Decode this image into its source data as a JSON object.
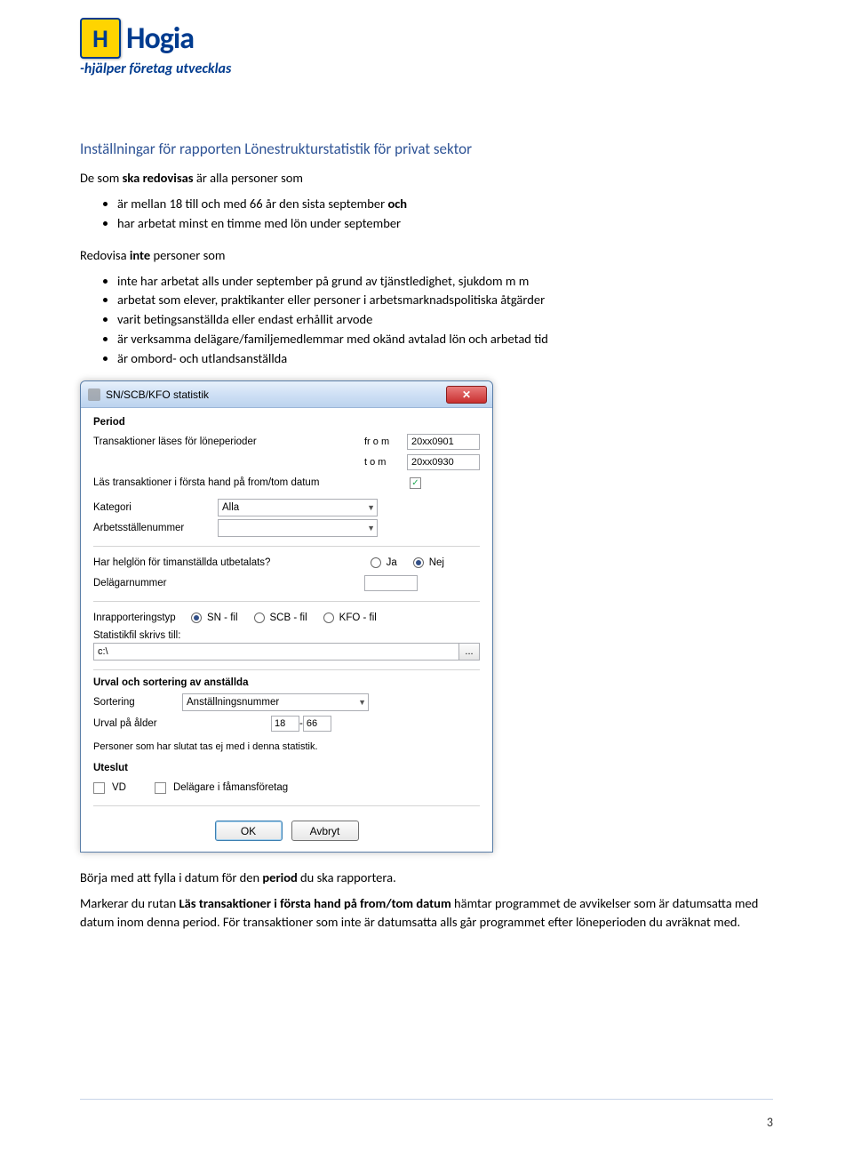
{
  "logo": {
    "letter": "H",
    "brand": "Hogia",
    "tagline": "-hjälper företag utvecklas"
  },
  "heading": "Inställningar för rapporten Lönestrukturstatistik för privat sektor",
  "intro1_pre": "De som ",
  "intro1_b": "ska redovisas",
  "intro1_post": " är alla personer som",
  "list1": {
    "i0_pre": "är mellan 18 till och med 66 år den sista september ",
    "i0_b": "och",
    "i1": "har arbetat minst en timme med lön under september"
  },
  "intro2_pre": "Redovisa ",
  "intro2_b": "inte",
  "intro2_post": " personer som",
  "list2": {
    "i0": "inte har arbetat alls under september på grund av tjänstledighet, sjukdom m m",
    "i1": "arbetat som elever, praktikanter eller personer i arbetsmarknadspolitiska åtgärder",
    "i2": "varit betingsanställda eller endast erhållit arvode",
    "i3": "är verksamma delägare/familjemedlemmar med okänd avtalad lön och arbetad tid",
    "i4": "är ombord- och utlandsanställda"
  },
  "dialog": {
    "title": "SN/SCB/KFO statistik",
    "period_title": "Period",
    "period_line": "Transaktioner läses för löneperioder",
    "from_lbl": "fr o m",
    "from_val": "20xx0901",
    "to_lbl": "t o m",
    "to_val": "20xx0930",
    "read_trans": "Läs transaktioner i första hand på from/tom datum",
    "kategori_lbl": "Kategori",
    "kategori_val": "Alla",
    "arbets_lbl": "Arbetsställenummer",
    "helglon": "Har helglön för timanställda utbetalats?",
    "ja": "Ja",
    "nej": "Nej",
    "delagarnr": "Delägarnummer",
    "inrapp": "Inrapporteringstyp",
    "sn": "SN - fil",
    "scb": "SCB - fil",
    "kfo": "KFO - fil",
    "statfil": "Statistikfil skrivs till:",
    "path": "c:\\",
    "urval_title": "Urval och sortering av anställda",
    "sort_lbl": "Sortering",
    "sort_val": "Anställningsnummer",
    "alder_lbl": "Urval på ålder",
    "alder_from": "18",
    "alder_sep": " - ",
    "alder_to": "66",
    "note": "Personer som har slutat tas ej med i denna statistik.",
    "uteslut_title": "Uteslut",
    "vd": "VD",
    "delagare": "Delägare i fåmansföretag",
    "ok": "OK",
    "avbryt": "Avbryt"
  },
  "outro": {
    "p1_pre": "Börja med att fylla i datum för den ",
    "p1_b": "period",
    "p1_post": " du ska rapportera.",
    "p2_pre": "Markerar du rutan ",
    "p2_b": "Läs transaktioner i första hand på from/tom datum",
    "p2_post": " hämtar programmet de avvikelser som är datumsatta med datum inom denna period. För transaktioner som inte är datumsatta alls går programmet efter löneperioden du avräknat med."
  },
  "page_no": "3"
}
